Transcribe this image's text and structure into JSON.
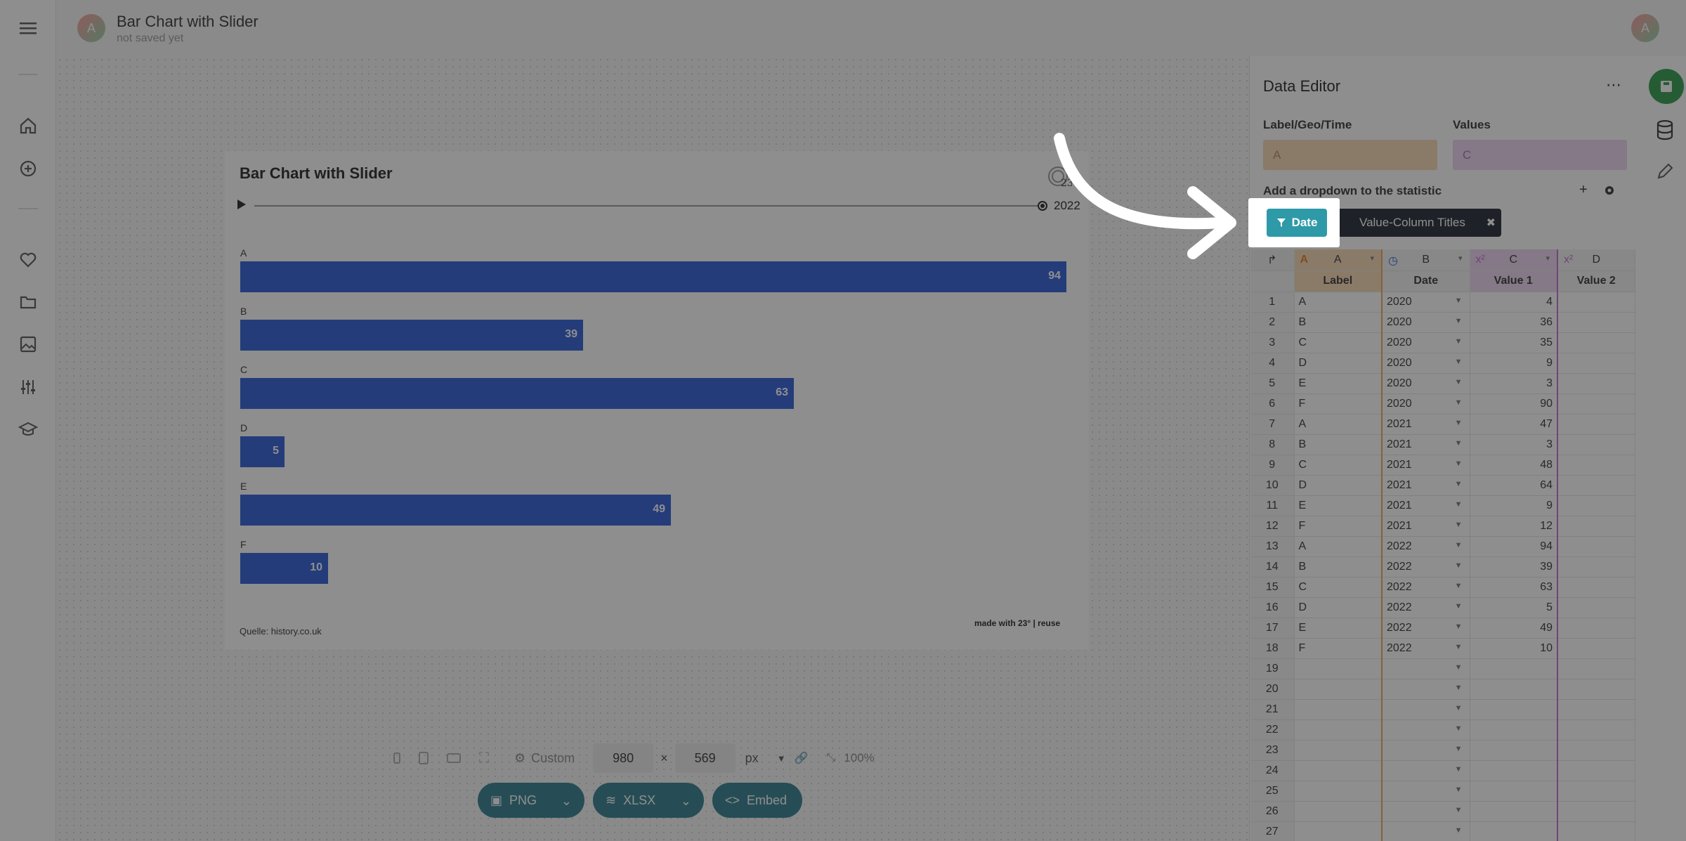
{
  "app": {
    "title": "Bar Chart with Slider",
    "status": "not saved yet",
    "avatar_letter": "A"
  },
  "sidebar": {
    "icons": [
      "menu-icon",
      "home-icon",
      "add-circle-icon",
      "heart-icon",
      "folder-icon",
      "image-icon",
      "sliders-icon",
      "graduation-cap-icon"
    ]
  },
  "chart": {
    "title": "Bar Chart with Slider",
    "logo_text": "23",
    "slider_year": "2022",
    "source": "Quelle: history.co.uk",
    "made_with": "made with 23° | reuse"
  },
  "chart_data": {
    "type": "bar",
    "orientation": "horizontal",
    "title": "Bar Chart with Slider",
    "categories": [
      "A",
      "B",
      "C",
      "D",
      "E",
      "F"
    ],
    "values": [
      94,
      39,
      63,
      5,
      49,
      10
    ],
    "xlim": [
      0,
      94
    ],
    "slider_value": "2022",
    "bar_color": "#2a5bd7"
  },
  "dimensions": {
    "preset": "Custom",
    "width": "980",
    "height": "569",
    "unit": "px",
    "zoom": "100%"
  },
  "export": {
    "png": "PNG",
    "xlsx": "XLSX",
    "embed": "Embed"
  },
  "editor": {
    "title": "Data Editor",
    "label_field_title": "Label/Geo/Time",
    "label_field_value": "A",
    "values_field_title": "Values",
    "values_field_value": "C",
    "dropdown_text": "Add a dropdown to the statistic",
    "filter_date": "Date",
    "filter_value_titles": "Value-Column Titles",
    "columns": [
      {
        "letter": "A",
        "header": "Label"
      },
      {
        "letter": "B",
        "header": "Date"
      },
      {
        "letter": "C",
        "header": "Value 1"
      },
      {
        "letter": "D",
        "header": "Value 2"
      }
    ],
    "rows": [
      {
        "n": "1",
        "label": "A",
        "date": "2020",
        "value": "4"
      },
      {
        "n": "2",
        "label": "B",
        "date": "2020",
        "value": "36"
      },
      {
        "n": "3",
        "label": "C",
        "date": "2020",
        "value": "35"
      },
      {
        "n": "4",
        "label": "D",
        "date": "2020",
        "value": "9"
      },
      {
        "n": "5",
        "label": "E",
        "date": "2020",
        "value": "3"
      },
      {
        "n": "6",
        "label": "F",
        "date": "2020",
        "value": "90"
      },
      {
        "n": "7",
        "label": "A",
        "date": "2021",
        "value": "47"
      },
      {
        "n": "8",
        "label": "B",
        "date": "2021",
        "value": "3"
      },
      {
        "n": "9",
        "label": "C",
        "date": "2021",
        "value": "48"
      },
      {
        "n": "10",
        "label": "D",
        "date": "2021",
        "value": "64"
      },
      {
        "n": "11",
        "label": "E",
        "date": "2021",
        "value": "9"
      },
      {
        "n": "12",
        "label": "F",
        "date": "2021",
        "value": "12"
      },
      {
        "n": "13",
        "label": "A",
        "date": "2022",
        "value": "94"
      },
      {
        "n": "14",
        "label": "B",
        "date": "2022",
        "value": "39"
      },
      {
        "n": "15",
        "label": "C",
        "date": "2022",
        "value": "63"
      },
      {
        "n": "16",
        "label": "D",
        "date": "2022",
        "value": "5"
      },
      {
        "n": "17",
        "label": "E",
        "date": "2022",
        "value": "49"
      },
      {
        "n": "18",
        "label": "F",
        "date": "2022",
        "value": "10"
      },
      {
        "n": "19",
        "label": "",
        "date": "",
        "value": ""
      },
      {
        "n": "20",
        "label": "",
        "date": "",
        "value": ""
      },
      {
        "n": "21",
        "label": "",
        "date": "",
        "value": ""
      },
      {
        "n": "22",
        "label": "",
        "date": "",
        "value": ""
      },
      {
        "n": "23",
        "label": "",
        "date": "",
        "value": ""
      },
      {
        "n": "24",
        "label": "",
        "date": "",
        "value": ""
      },
      {
        "n": "25",
        "label": "",
        "date": "",
        "value": ""
      },
      {
        "n": "26",
        "label": "",
        "date": "",
        "value": ""
      },
      {
        "n": "27",
        "label": "",
        "date": "",
        "value": ""
      }
    ]
  },
  "colors": {
    "accent": "#2e9aa8",
    "bar": "#2a5bd7",
    "label_col": "#f0a25a",
    "value_col": "#c36ad6",
    "save": "#2e9a4a"
  }
}
